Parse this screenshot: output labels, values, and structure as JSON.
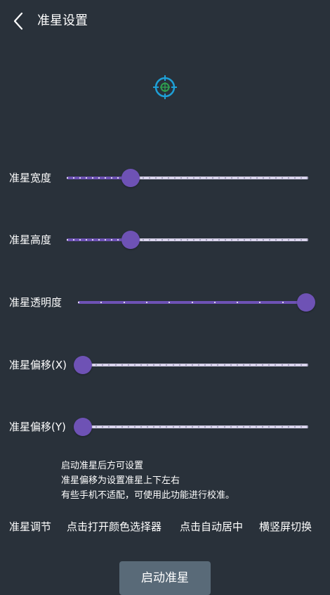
{
  "header": {
    "title": "准星设置",
    "back_icon": "chevron-left-icon"
  },
  "preview": {
    "icon": "crosshair-icon",
    "colors": {
      "outer": "#1e9fd6",
      "inner": "#2e9e4f"
    }
  },
  "colors": {
    "background": "#29313a",
    "accent": "#6e52b5",
    "track": "#d9d4ec",
    "button": "#596a78"
  },
  "sliders": [
    {
      "key": "width",
      "label": "准星宽度",
      "value": 0.265
    },
    {
      "key": "height",
      "label": "准星高度",
      "value": 0.265
    },
    {
      "key": "opacity",
      "label": "准星透明度",
      "value": 1.0
    },
    {
      "key": "offset_x",
      "label": "准星偏移(X)",
      "value": 0.0
    },
    {
      "key": "offset_y",
      "label": "准星偏移(Y)",
      "value": 0.0
    }
  ],
  "notes": [
    "启动准星后方可设置",
    "准星偏移为设置准星上下左右",
    "有些手机不适配，可使用此功能进行校准。"
  ],
  "actions": [
    {
      "key": "adjust",
      "label": "准星调节"
    },
    {
      "key": "color",
      "label": "点击打开颜色选择器"
    },
    {
      "key": "center",
      "label": "点击自动居中"
    },
    {
      "key": "rotate",
      "label": "横竖屏切换"
    }
  ],
  "start_button": {
    "label": "启动准星"
  }
}
